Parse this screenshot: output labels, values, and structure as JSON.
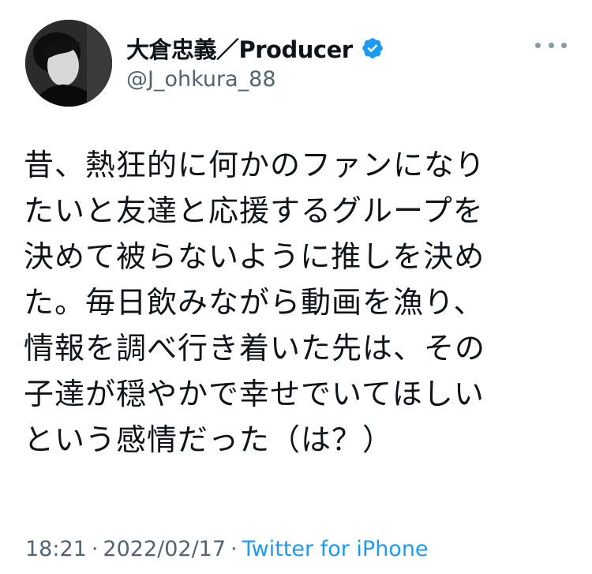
{
  "user": {
    "display_name": "大倉忠義／Producer",
    "handle": "@J_ohkura_88",
    "verified_icon": "verified-badge-icon"
  },
  "tweet": {
    "text": "昔、熱狂的に何かのファンになり\nたいと友達と応援するグループを\n決めて被らないように推しを決め\nた。毎日飲みながら動画を漁り、\n情報を調べ行き着いた先は、その\n子達が穏やかで幸せでいてほしい\nという感情だった（は？）",
    "time": "18:21",
    "separator": "·",
    "date": "2022/02/17",
    "source": "Twitter for iPhone"
  },
  "colors": {
    "accent": "#1d9bf0",
    "secondary_text": "#536471"
  }
}
